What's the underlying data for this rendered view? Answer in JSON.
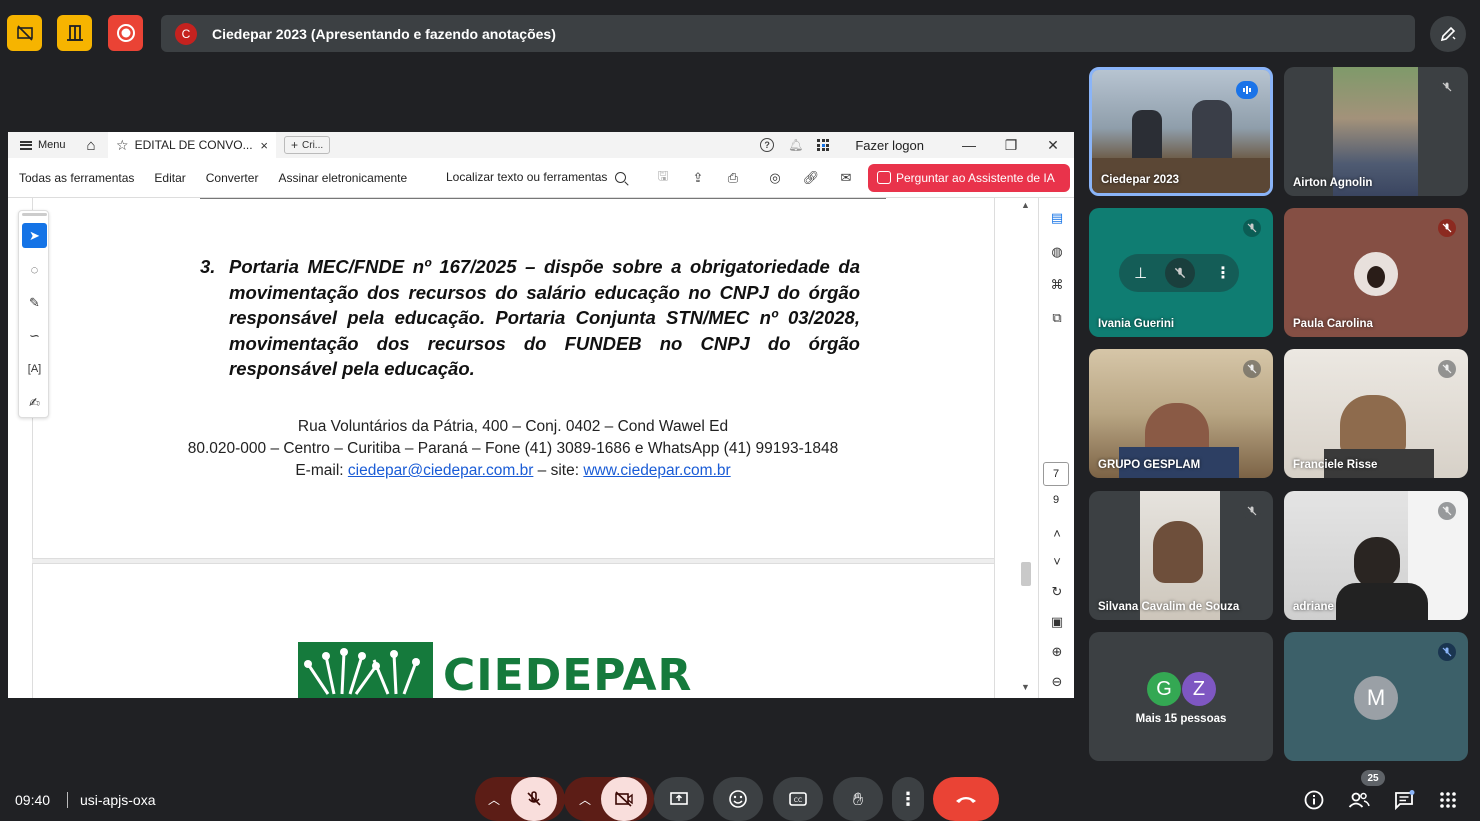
{
  "colors": {
    "accent_yellow": "#f6b400",
    "record_red": "#ea4335",
    "meet_bg": "#202124",
    "tile_bg": "#3c4043",
    "acrobat_ai": "#e9334b",
    "ciedepar_green": "#157a3c"
  },
  "topbar": {
    "presenter_initial": "C",
    "presentation_title": "Ciedepar 2023 (Apresentando e fazendo anotações)"
  },
  "acrobat": {
    "menu_label": "Menu",
    "active_tab": "EDITAL DE CONVO...",
    "new_tab": "Cri...",
    "help_icon_glyph": "?",
    "login_label": "Fazer logon",
    "toolbar": {
      "all_tools": "Todas as ferramentas",
      "edit": "Editar",
      "convert": "Converter",
      "sign": "Assinar eletronicamente",
      "search": "Localizar texto ou ferramentas",
      "ai_assistant": "Perguntar ao Assistente de IA"
    },
    "document": {
      "item_number": "3.",
      "item_text": "Portaria MEC/FNDE nº 167/2025 – dispõe sobre a obrigatoriedade da movimentação dos recursos do salário educação no CNPJ do órgão responsável pela educação. Portaria Conjunta STN/MEC nº 03/2028, movimentação dos recursos do FUNDEB no CNPJ do órgão responsável pela educação.",
      "address_line1": "Rua Voluntários da Pátria, 400 – Conj. 0402 – Cond Wawel Ed",
      "address_line2": "80.020-000 – Centro – Curitiba – Paraná – Fone (41) 3089-1686 e WhatsApp (41) 99193-1848",
      "email_prefix": "E-mail: ",
      "email": "ciedepar@ciedepar.com.br",
      "site_prefix": " – site: ",
      "site": "www.ciedepar.com.br",
      "logo_text": "CIEDEPAR"
    },
    "page_current": "7",
    "page_total": "9"
  },
  "participants": {
    "tiles": [
      {
        "name": "Ciedepar 2023"
      },
      {
        "name": "Airton Agnolin"
      },
      {
        "name": "Ivania Guerini"
      },
      {
        "name": "Paula Carolina"
      },
      {
        "name": "GRUPO GESPLAM"
      },
      {
        "name": "Franciele Risse"
      },
      {
        "name": "Silvana Cavalim de Souza"
      },
      {
        "name": "adriane"
      }
    ],
    "more_avatars": [
      "G",
      "Z"
    ],
    "more_label": "Mais 15 pessoas",
    "last_avatar": "M"
  },
  "bottombar": {
    "time": "09:40",
    "meeting_code": "usi-apjs-oxa",
    "people_count": "25"
  }
}
